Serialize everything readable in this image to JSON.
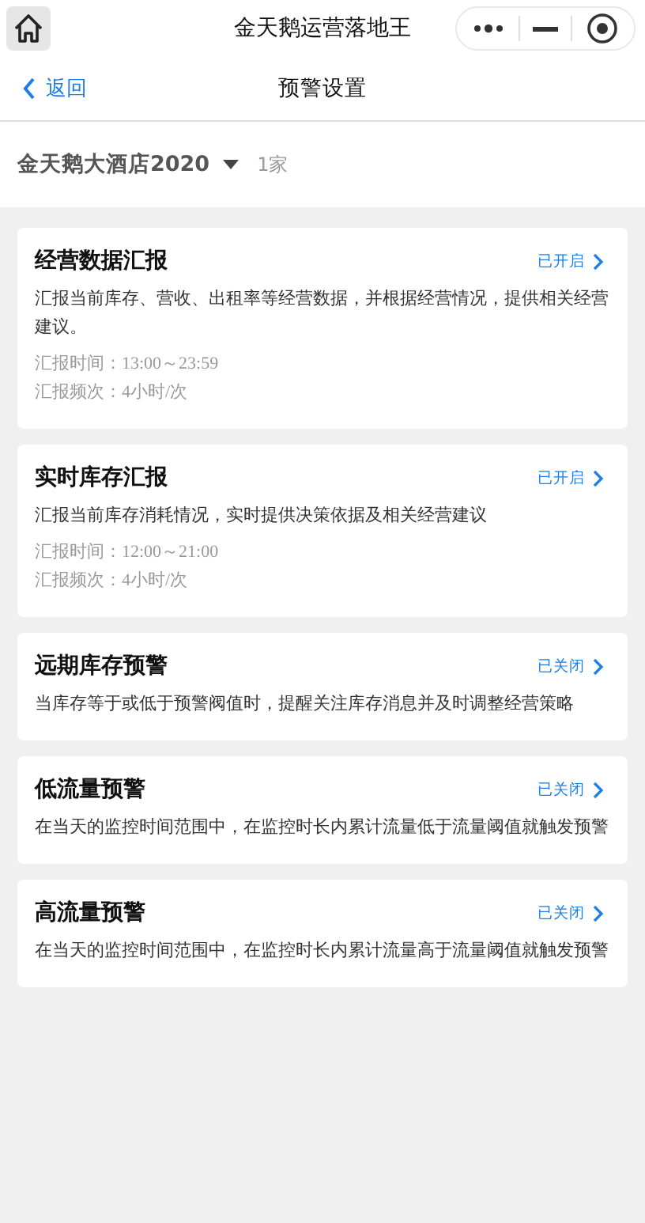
{
  "app_bar": {
    "title": "金天鹅运营落地王"
  },
  "nav": {
    "back": "返回",
    "title": "预警设置"
  },
  "hotel": {
    "name": "金天鹅大酒店2020",
    "count": "1家"
  },
  "cards": [
    {
      "title": "经营数据汇报",
      "status": "已开启",
      "description": "汇报当前库存、营收、出租率等经营数据，并根据经营情况，提供相关经营建议。",
      "details": [
        "汇报时间：13:00～23:59",
        "汇报频次：4小时/次"
      ]
    },
    {
      "title": "实时库存汇报",
      "status": "已开启",
      "description": "汇报当前库存消耗情况，实时提供决策依据及相关经营建议",
      "details": [
        "汇报时间：12:00～21:00",
        "汇报频次：4小时/次"
      ]
    },
    {
      "title": "远期库存预警",
      "status": "已关闭",
      "description": "当库存等于或低于预警阀值时，提醒关注库存消息并及时调整经营策略"
    },
    {
      "title": "低流量预警",
      "status": "已关闭",
      "description": "在当天的监控时间范围中，在监控时长内累计流量低于流量阈值就触发预警"
    },
    {
      "title": "高流量预警",
      "status": "已关闭",
      "description": "在当天的监控时间范围中，在监控时长内累计流量高于流量阈值就触发预警"
    }
  ]
}
